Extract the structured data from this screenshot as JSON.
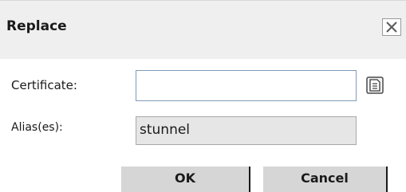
{
  "dialog": {
    "title": "Replace",
    "close_icon": "close-icon"
  },
  "form": {
    "certificate_label": "Certificate:",
    "certificate_value": "",
    "browse_icon": "browse-file-icon",
    "alias_label": "Alias(es):",
    "alias_value": "stunnel"
  },
  "buttons": {
    "ok_label": "OK",
    "cancel_label": "Cancel"
  },
  "colors": {
    "titlebar_bg": "#efefef",
    "button_bg": "#d6d6d6",
    "readonly_field_bg": "#e6e6e6",
    "input_border": "#7f9db9"
  }
}
